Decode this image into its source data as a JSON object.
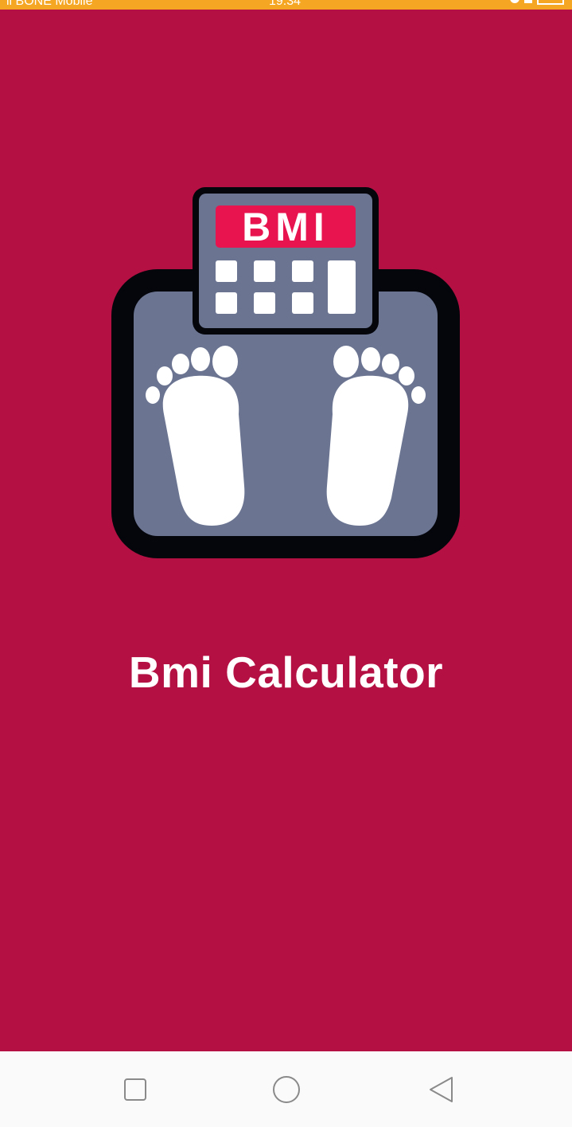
{
  "status_bar": {
    "carrier": "ll BONE Mobile",
    "time": "19:34"
  },
  "logo": {
    "badge_text": "BMI",
    "icon": "bathroom-scale-icon"
  },
  "app": {
    "title": "Bmi Calculator"
  },
  "colors": {
    "background": "#b51043",
    "status_bar": "#f5a623",
    "scale_body": "#6b7592",
    "badge": "#e8144f",
    "nav_bar": "#fafafa"
  },
  "nav": {
    "recents_icon": "square-icon",
    "home_icon": "circle-icon",
    "back_icon": "triangle-back-icon"
  }
}
